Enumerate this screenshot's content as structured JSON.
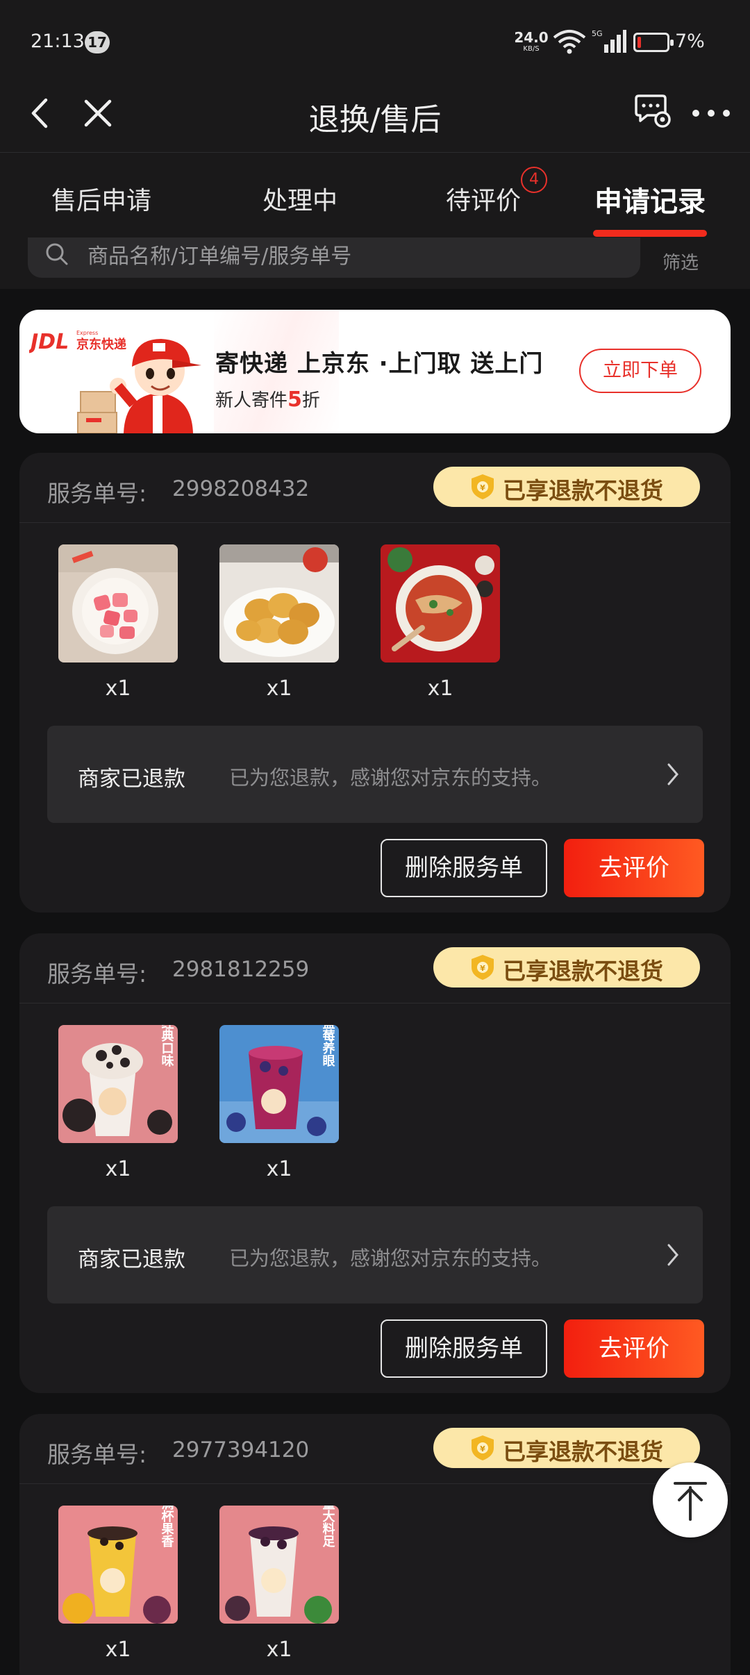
{
  "status_bar": {
    "time": "21:13",
    "notification_count": "17",
    "net_speed": "24.0",
    "net_speed_unit": "KB/S",
    "battery": "7%"
  },
  "nav": {
    "title": "退换/售后"
  },
  "tabs": [
    {
      "label": "售后申请",
      "active": false
    },
    {
      "label": "处理中",
      "active": false
    },
    {
      "label": "待评价",
      "active": false,
      "badge": "4"
    },
    {
      "label": "申请记录",
      "active": true
    }
  ],
  "search": {
    "placeholder": "商品名称/订单编号/服务单号",
    "filter_label": "筛选"
  },
  "banner": {
    "logo_text": "JDL 京东快递",
    "title": "寄快递 上京东 ·上门取 送上门",
    "subtitle_prefix": "新人寄件",
    "subtitle_highlight": "5",
    "subtitle_suffix": "折",
    "button": "立即下单",
    "accent_color": "#e8312b"
  },
  "service_orders": [
    {
      "label": "服务单号:",
      "number": "2998208432",
      "badge": "已享退款不退货",
      "products": [
        {
          "image": "pink-pickled-radish",
          "qty": "x1"
        },
        {
          "image": "fried-dough-nuggets",
          "qty": "x1"
        },
        {
          "image": "noodle-dish-red-table",
          "qty": "x1"
        }
      ],
      "status_title": "商家已退款",
      "status_desc": "已为您退款，感谢您对京东的支持。",
      "delete_label": "删除服务单",
      "review_label": "去评价"
    },
    {
      "label": "服务单号:",
      "number": "2981812259",
      "badge": "已享退款不退货",
      "products": [
        {
          "image": "oreo-sundae",
          "qty": "x1",
          "tag": "经典口味"
        },
        {
          "image": "blueberry-drink",
          "qty": "x1",
          "tag": "蓝莓养眼"
        }
      ],
      "status_title": "商家已退款",
      "status_desc": "已为您退款，感谢您对京东的支持。",
      "delete_label": "删除服务单",
      "review_label": "去评价"
    },
    {
      "label": "服务单号:",
      "number": "2977394120",
      "badge": "已享退款不退货",
      "products": [
        {
          "image": "passion-fruit-tea",
          "qty": "x1",
          "tag": "满杯果香"
        },
        {
          "image": "mulberry-tea",
          "qty": "x1",
          "tag": "量大料足"
        }
      ]
    }
  ],
  "colors": {
    "background": "#111112",
    "card": "#1c1b1d",
    "accent_red": "#f22b1d",
    "badge_gold": "#fce7a9"
  }
}
